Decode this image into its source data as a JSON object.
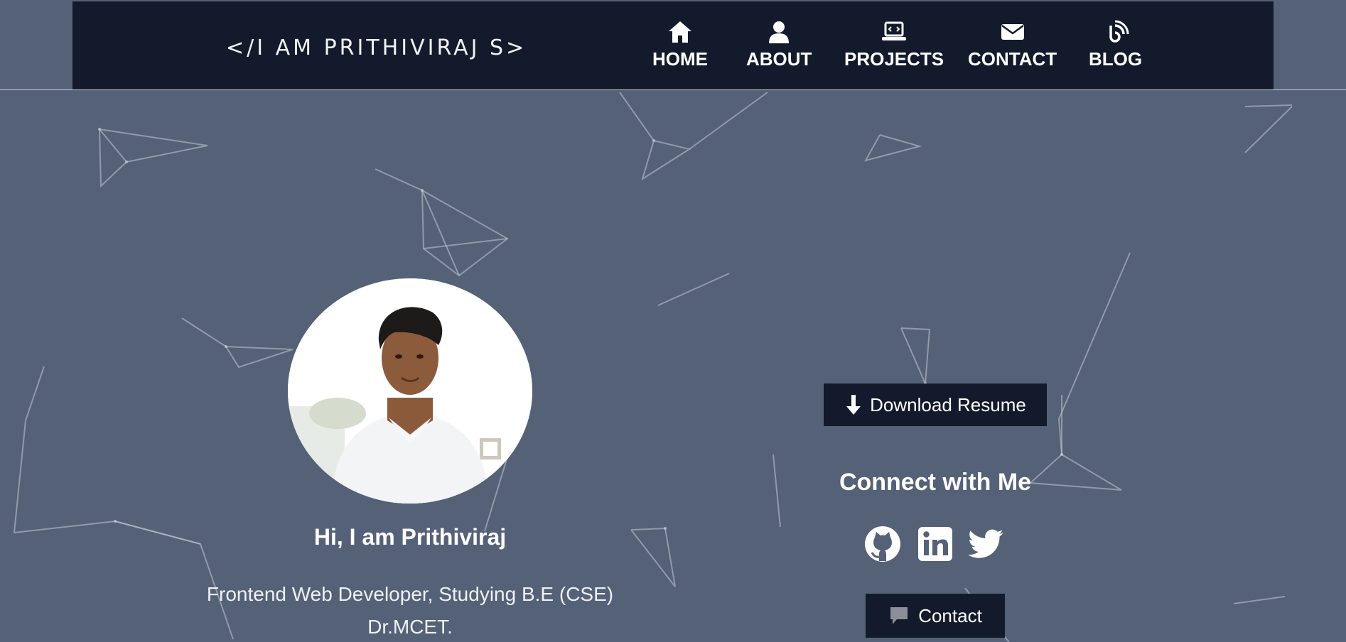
{
  "header": {
    "brand": "</I AM PRITHIVIRAJ S>",
    "nav": [
      {
        "label": "HOME",
        "icon": "home-icon"
      },
      {
        "label": "ABOUT",
        "icon": "user-icon"
      },
      {
        "label": "PROJECTS",
        "icon": "laptop-code-icon"
      },
      {
        "label": "CONTACT",
        "icon": "envelope-icon"
      },
      {
        "label": "BLOG",
        "icon": "blog-icon"
      }
    ]
  },
  "hero": {
    "greeting": "Hi, I am Prithiviraj",
    "subtitle_line1": "Frontend Web Developer, Studying B.E (CSE)",
    "subtitle_line2": "Dr.MCET."
  },
  "actions": {
    "download_label": "Download Resume",
    "connect_title": "Connect with Me",
    "socials": [
      "github-icon",
      "linkedin-icon",
      "twitter-icon"
    ],
    "contact_label": "Contact"
  },
  "colors": {
    "background": "#556177",
    "navbar": "#121a2b",
    "button": "#121a2b",
    "text": "#ffffff"
  }
}
